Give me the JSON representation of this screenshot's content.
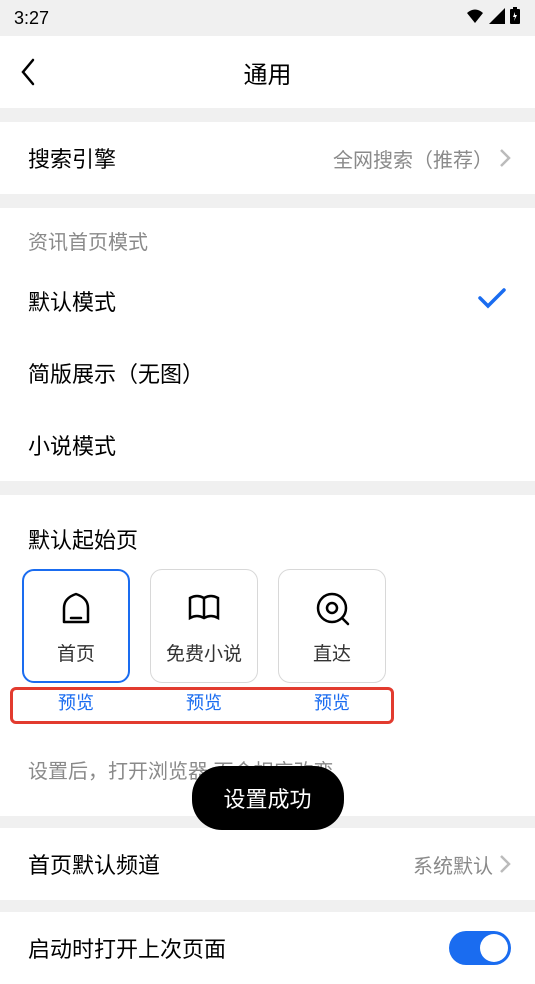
{
  "status": {
    "time": "3:27"
  },
  "header": {
    "title": "通用"
  },
  "search_engine": {
    "label": "搜索引擎",
    "value": "全网搜索（推荐）"
  },
  "home_mode": {
    "section_title": "资讯首页模式",
    "options": {
      "default": "默认模式",
      "simple": "简版展示（无图）",
      "novel": "小说模式"
    }
  },
  "start_page": {
    "title": "默认起始页",
    "cards": {
      "home": "首页",
      "novel": "免费小说",
      "direct": "直达"
    },
    "preview": "预览",
    "hint": "设置后，打开浏览器                面会相应改变"
  },
  "default_channel": {
    "label": "首页默认频道",
    "value": "系统默认"
  },
  "open_last": {
    "label": "启动时打开上次页面"
  },
  "toast": "设置成功"
}
